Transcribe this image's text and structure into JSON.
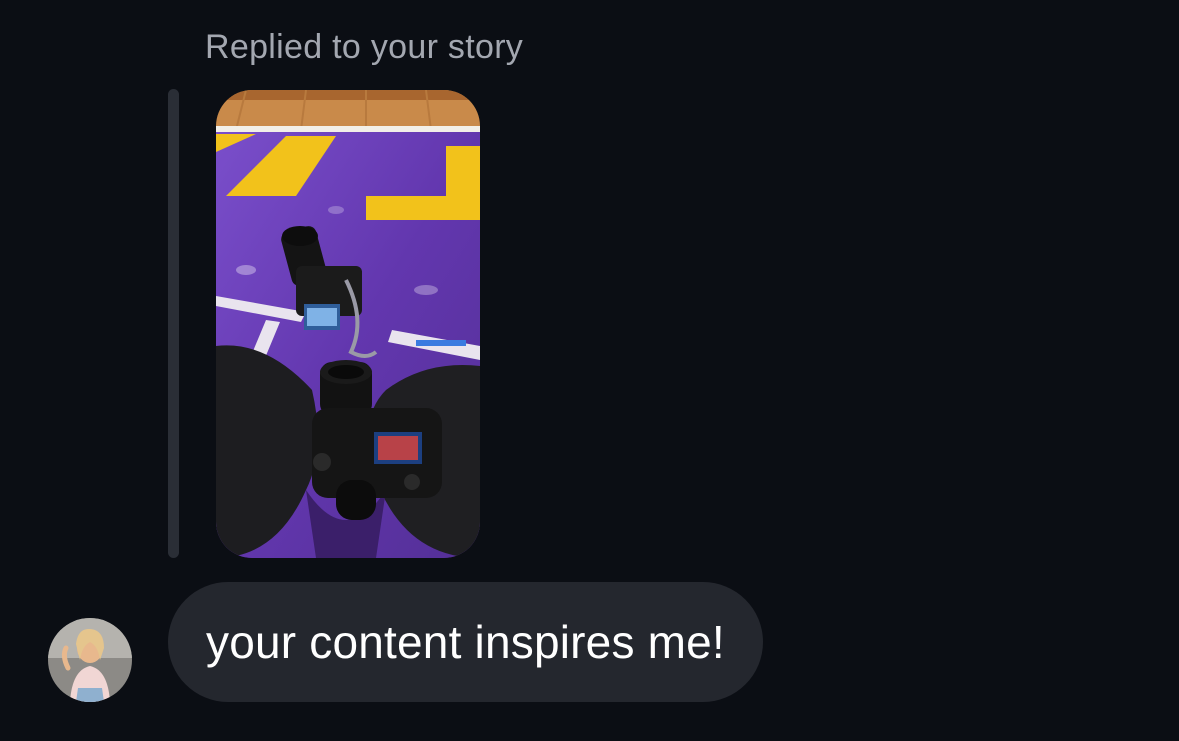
{
  "story_reply": {
    "label": "Replied to your story",
    "thumbnail_icon": "story-photo-cameras-on-court"
  },
  "message": {
    "text": "your content inspires me!",
    "sender_avatar_icon": "user-avatar-photo"
  },
  "colors": {
    "background": "#0b0e14",
    "bubble": "#24272e",
    "label_text": "#a3a7b0",
    "message_text": "#ffffff",
    "quote_bar": "#2a2e36"
  }
}
